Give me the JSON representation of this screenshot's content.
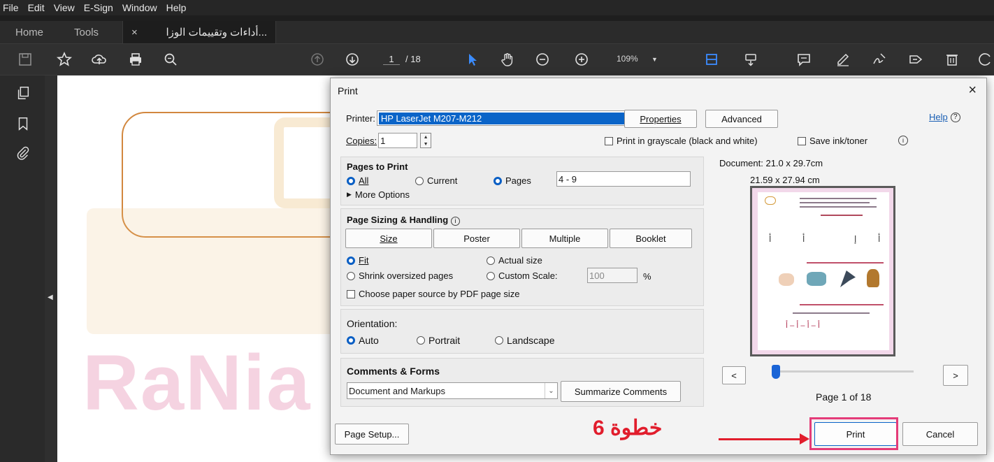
{
  "menubar": [
    "File",
    "Edit",
    "View",
    "E-Sign",
    "Window",
    "Help"
  ],
  "tabs": {
    "home": "Home",
    "tools": "Tools",
    "document": "أداءات وتقييمات الوزا...",
    "close": "×"
  },
  "toolbar": {
    "page_current": "1",
    "page_total": "/ 18",
    "zoom": "109%"
  },
  "watermark": {
    "latin": "RaNia SaYed"
  },
  "dialog": {
    "title": "Print",
    "close": "×",
    "printer_label": "Printer:",
    "printer_value": "HP LaserJet M207-M212",
    "properties": "Properties",
    "advanced": "Advanced",
    "help": "Help",
    "copies_label": "Copies:",
    "copies_value": "1",
    "grayscale": "Print in grayscale (black and white)",
    "save_ink": "Save ink/toner",
    "pages_title": "Pages to Print",
    "all": "All",
    "current": "Current",
    "pages": "Pages",
    "pages_value": "4 - 9",
    "more_options": "More Options",
    "sizing_title": "Page Sizing & Handling",
    "size": "Size",
    "poster": "Poster",
    "multiple": "Multiple",
    "booklet": "Booklet",
    "fit": "Fit",
    "actual_size": "Actual size",
    "shrink": "Shrink oversized pages",
    "custom_scale": "Custom Scale:",
    "custom_scale_value": "100",
    "percent": "%",
    "paper_source": "Choose paper source by PDF page size",
    "orientation_title": "Orientation:",
    "auto": "Auto",
    "portrait": "Portrait",
    "landscape": "Landscape",
    "comments_title": "Comments & Forms",
    "comments_value": "Document and Markups",
    "summarize": "Summarize Comments",
    "doc_size": "Document: 21.0 x 29.7cm",
    "paper_size": "21.59 x 27.94 cm",
    "prev": "<",
    "next": ">",
    "page_of": "Page 1 of 18",
    "page_setup": "Page Setup...",
    "print": "Print",
    "cancel": "Cancel"
  },
  "annotation": {
    "text": "خطوة 6"
  },
  "colors": {
    "accent": "#0a64c8",
    "annotation": "#e11d2c",
    "highlight": "#e43b78"
  }
}
